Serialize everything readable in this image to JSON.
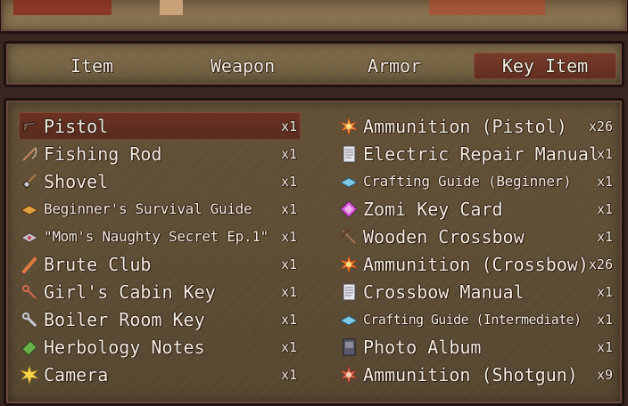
{
  "tabs": [
    {
      "label": "Item"
    },
    {
      "label": "Weapon"
    },
    {
      "label": "Armor"
    },
    {
      "label": "Key Item",
      "selected": true
    }
  ],
  "left_items": [
    {
      "name": "Pistol",
      "qty": "x1",
      "icon": "pistol-icon",
      "selected": true
    },
    {
      "name": "Fishing Rod",
      "qty": "x1",
      "icon": "fishing-rod-icon"
    },
    {
      "name": "Shovel",
      "qty": "x1",
      "icon": "shovel-icon"
    },
    {
      "name": "Beginner's Survival Guide",
      "qty": "x1",
      "icon": "book-icon"
    },
    {
      "name": "\"Mom's Naughty Secret Ep.1\"",
      "qty": "x1",
      "icon": "magazine-icon"
    },
    {
      "name": "Brute Club",
      "qty": "x1",
      "icon": "club-icon"
    },
    {
      "name": "Girl's Cabin Key",
      "qty": "x1",
      "icon": "key-icon"
    },
    {
      "name": "Boiler Room Key",
      "qty": "x1",
      "icon": "key-icon"
    },
    {
      "name": "Herbology Notes",
      "qty": "x1",
      "icon": "notes-icon"
    },
    {
      "name": "Camera",
      "qty": "x1",
      "icon": "camera-flash-icon"
    }
  ],
  "right_items": [
    {
      "name": "Ammunition (Pistol)",
      "qty": "x26",
      "icon": "ammo-icon"
    },
    {
      "name": "Electric Repair Manual",
      "qty": "x1",
      "icon": "manual-icon"
    },
    {
      "name": "Crafting Guide (Beginner)",
      "qty": "x1",
      "icon": "guide-book-icon"
    },
    {
      "name": "Zomi Key Card",
      "qty": "x1",
      "icon": "keycard-icon"
    },
    {
      "name": "Wooden Crossbow",
      "qty": "x1",
      "icon": "crossbow-icon"
    },
    {
      "name": "Ammunition (Crossbow)",
      "qty": "x26",
      "icon": "ammo-icon"
    },
    {
      "name": "Crossbow Manual",
      "qty": "x1",
      "icon": "manual-icon"
    },
    {
      "name": "Crafting Guide (Intermediate)",
      "qty": "x1",
      "icon": "guide-book-icon"
    },
    {
      "name": "Photo Album",
      "qty": "x1",
      "icon": "album-icon"
    },
    {
      "name": "Ammunition (Shotgun)",
      "qty": "x9",
      "icon": "ammo-icon"
    }
  ]
}
